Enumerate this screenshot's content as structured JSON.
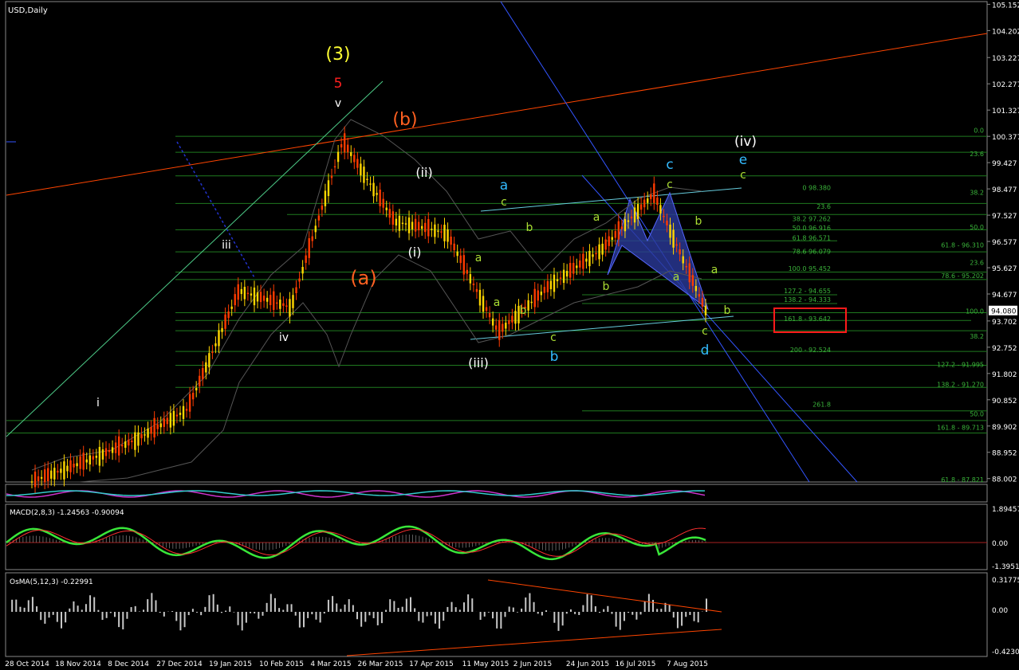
{
  "symbol_title": "USD,Daily",
  "colors": {
    "bg": "#000000",
    "frame": "#ffffff",
    "grid_green": "#1f7a1f",
    "candle_up": "#ffd700",
    "candle_down": "#ff3b00",
    "red_line": "#ff4500",
    "teal_line": "#66d9a8",
    "blue_line": "#3355ff",
    "macd_main": "#39e639",
    "macd_signal": "#ff3030",
    "osma_bar": "#c8c8c8",
    "fib_text": "#3ab33a"
  },
  "price_axis": [
    "105.152",
    "104.202",
    "103.227",
    "102.277",
    "101.327",
    "100.377",
    "99.427",
    "98.477",
    "97.527",
    "96.577",
    "95.627",
    "94.677",
    "93.702",
    "92.752",
    "91.802",
    "90.852",
    "89.902",
    "88.952",
    "88.002"
  ],
  "current_price": "94.080",
  "date_axis": [
    "28 Oct 2014",
    "18 Nov 2014",
    "8 Dec 2014",
    "27 Dec 2014",
    "19 Jan 2015",
    "10 Feb 2015",
    "4 Mar 2015",
    "26 Mar 2015",
    "17 Apr 2015",
    "11 May 2015",
    "2 Jun 2015",
    "24 Jun 2015",
    "16 Jul 2015",
    "7 Aug 2015"
  ],
  "wave_labels": [
    {
      "t": "(3)",
      "c": "#ffff33"
    },
    {
      "t": "5",
      "c": "#ff2020"
    },
    {
      "t": "v",
      "c": "#ffffff"
    },
    {
      "t": "iii",
      "c": "#ffffff"
    },
    {
      "t": "i",
      "c": "#ffffff"
    },
    {
      "t": "iv",
      "c": "#ffffff"
    },
    {
      "t": "(b)",
      "c": "#ff6020"
    },
    {
      "t": "(a)",
      "c": "#ff6020"
    },
    {
      "t": "(ii)",
      "c": "#ffffff"
    },
    {
      "t": "(i)",
      "c": "#ffffff"
    },
    {
      "t": "(iii)",
      "c": "#ffffff"
    },
    {
      "t": "(iv)",
      "c": "#ffffff"
    },
    {
      "t": "a",
      "c": "#33bbff"
    },
    {
      "t": "b",
      "c": "#33bbff"
    },
    {
      "t": "c",
      "c": "#33bbff"
    },
    {
      "t": "d",
      "c": "#33bbff"
    },
    {
      "t": "e",
      "c": "#33bbff"
    },
    {
      "t": "c",
      "c": "#aadd33"
    },
    {
      "t": "b",
      "c": "#aadd33"
    },
    {
      "t": "a",
      "c": "#aadd33"
    },
    {
      "t": "a",
      "c": "#aadd33"
    },
    {
      "t": "b",
      "c": "#aadd33"
    },
    {
      "t": "c",
      "c": "#aadd33"
    },
    {
      "t": "a",
      "c": "#aadd33"
    },
    {
      "t": "b",
      "c": "#aadd33"
    },
    {
      "t": "c",
      "c": "#aadd33"
    },
    {
      "t": "b",
      "c": "#aadd33"
    },
    {
      "t": "a",
      "c": "#aadd33"
    },
    {
      "t": "a",
      "c": "#aadd33"
    },
    {
      "t": "b",
      "c": "#aadd33"
    },
    {
      "t": "c",
      "c": "#aadd33"
    },
    {
      "t": "c",
      "c": "#aadd33"
    }
  ],
  "fib_labels": [
    "0.0",
    "23.6",
    "0 98.380",
    "38.2",
    "23.6",
    "38.2 97.262",
    "50.0",
    "50.0 96.916",
    "61.8 96.571",
    "61.8 - 96.310",
    "78.6 96.079",
    "23.6",
    "100.0 95.452",
    "78.6 - 95.202",
    "127.2 - 94.655",
    "138.2 - 94.333",
    "100.0",
    "161.8 - 93.642",
    "38.2",
    "200 - 92.524",
    "127.2 - 91.995",
    "138.2 - 91.270",
    "261.8",
    "50.0",
    "161.8 - 89.713",
    "61.8 - 87.821"
  ],
  "macd": {
    "title": "MACD(2,8,3) -1.24563 -0.90094",
    "axis": [
      "1.89457",
      "0.00",
      "-1.39516"
    ]
  },
  "osma": {
    "title": "OsMA(5,12,3) -0.22991",
    "axis": [
      "0.31775",
      "0.00",
      "-0.42305"
    ]
  },
  "chart_data": {
    "type": "line",
    "title": "USD,Daily",
    "x": [
      "28 Oct 2014",
      "18 Nov 2014",
      "8 Dec 2014",
      "27 Dec 2014",
      "19 Jan 2015",
      "10 Feb 2015",
      "4 Mar 2015",
      "26 Mar 2015",
      "17 Apr 2015",
      "11 May 2015",
      "2 Jun 2015",
      "24 Jun 2015",
      "16 Jul 2015",
      "7 Aug 2015"
    ],
    "series": [
      {
        "values": [
          87.9,
          88.6,
          89.4,
          90.5,
          94.8,
          94.2,
          100.2,
          97.3,
          96.9,
          93.3,
          95.0,
          96.3,
          98.3,
          94.1
        ]
      }
    ],
    "ylim": [
      87.8,
      105.3
    ]
  }
}
